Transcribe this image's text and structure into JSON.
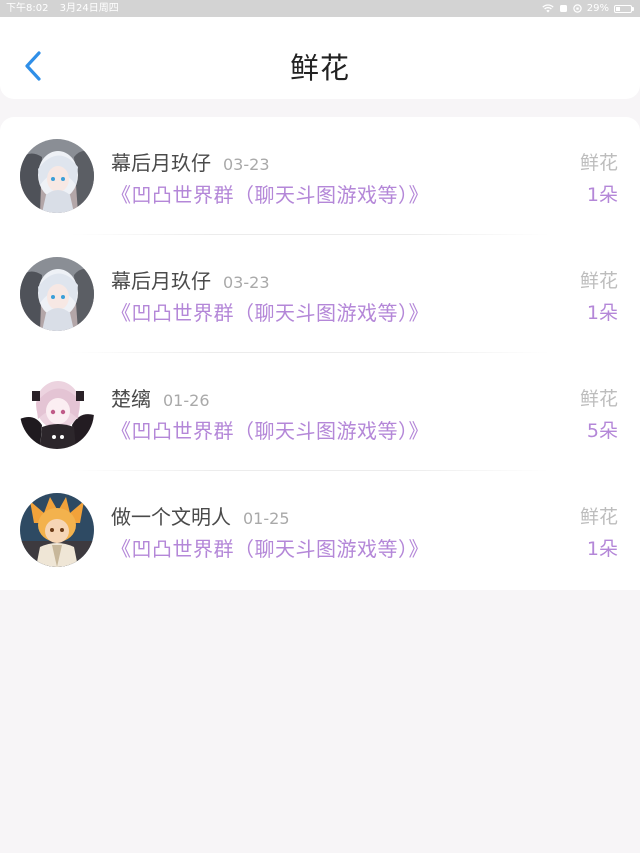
{
  "status_bar": {
    "time": "下午8:02",
    "date": "3月24日周四",
    "battery": "29%",
    "battery_fraction": 0.29
  },
  "nav": {
    "title": "鲜花"
  },
  "records": [
    {
      "name": "幕后月玖仔",
      "date": "03-23",
      "group": "《凹凸世界群（聊天斗图游戏等）》",
      "gift": "鲜花",
      "count": "1朵",
      "avatar": "anime-avatar-white-hair"
    },
    {
      "name": "幕后月玖仔",
      "date": "03-23",
      "group": "《凹凸世界群（聊天斗图游戏等）》",
      "gift": "鲜花",
      "count": "1朵",
      "avatar": "anime-avatar-white-hair"
    },
    {
      "name": "楚缡",
      "date": "01-26",
      "group": "《凹凸世界群（聊天斗图游戏等）》",
      "gift": "鲜花",
      "count": "5朵",
      "avatar": "anime-avatar-pink-hair"
    },
    {
      "name": "做一个文明人",
      "date": "01-25",
      "group": "《凹凸世界群（聊天斗图游戏等）》",
      "gift": "鲜花",
      "count": "1朵",
      "avatar": "anime-avatar-orange-hair"
    }
  ],
  "colors": {
    "accent": "#2f8fe8",
    "purple": "#b487d8",
    "muted": "#bdbdbd",
    "background": "#f7f5f7"
  }
}
